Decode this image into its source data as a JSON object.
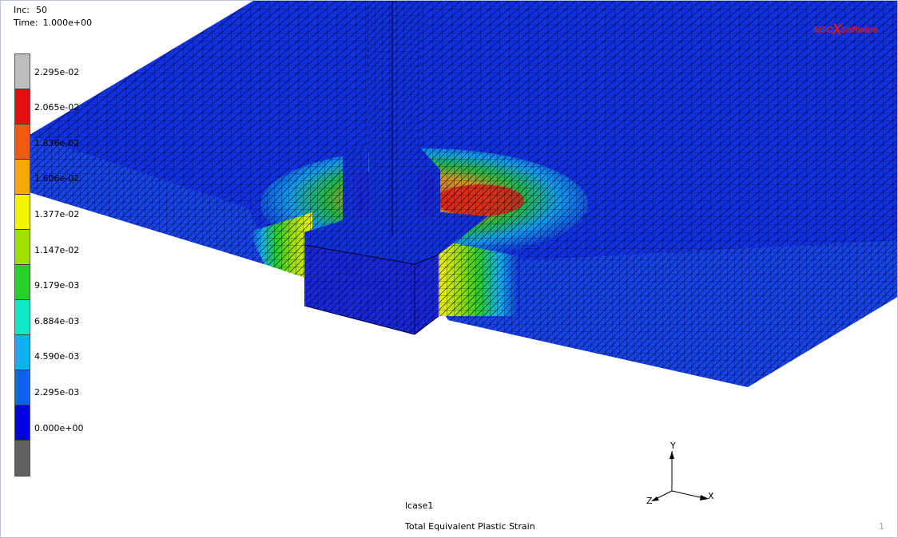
{
  "header": {
    "inc_label": "Inc:",
    "inc_value": "50",
    "time_label": "Time:",
    "time_value": "1.000e+00"
  },
  "logo": {
    "left_text": "MSC",
    "mark": "X",
    "right_text": "Software",
    "color": "#d41818"
  },
  "legend": {
    "colors": [
      "#bdbdbd",
      "#e31010",
      "#f25a10",
      "#f5a800",
      "#f4f400",
      "#9ee000",
      "#28d028",
      "#10e8c8",
      "#10b0f0",
      "#1060f0",
      "#0000e0",
      "#606060"
    ],
    "labels": [
      "2.295e-02",
      "2.065e-02",
      "1.836e-02",
      "1.606e-02",
      "1.377e-02",
      "1.147e-02",
      "9.179e-03",
      "6.884e-03",
      "4.590e-03",
      "2.295e-03",
      "0.000e+00"
    ]
  },
  "triad": {
    "x_label": "X",
    "y_label": "Y",
    "z_label": "Z"
  },
  "footer": {
    "case_name": "lcase1",
    "result_name": "Total Equivalent Plastic Strain",
    "page_number": "1"
  },
  "mesh_color": "#1232e0"
}
